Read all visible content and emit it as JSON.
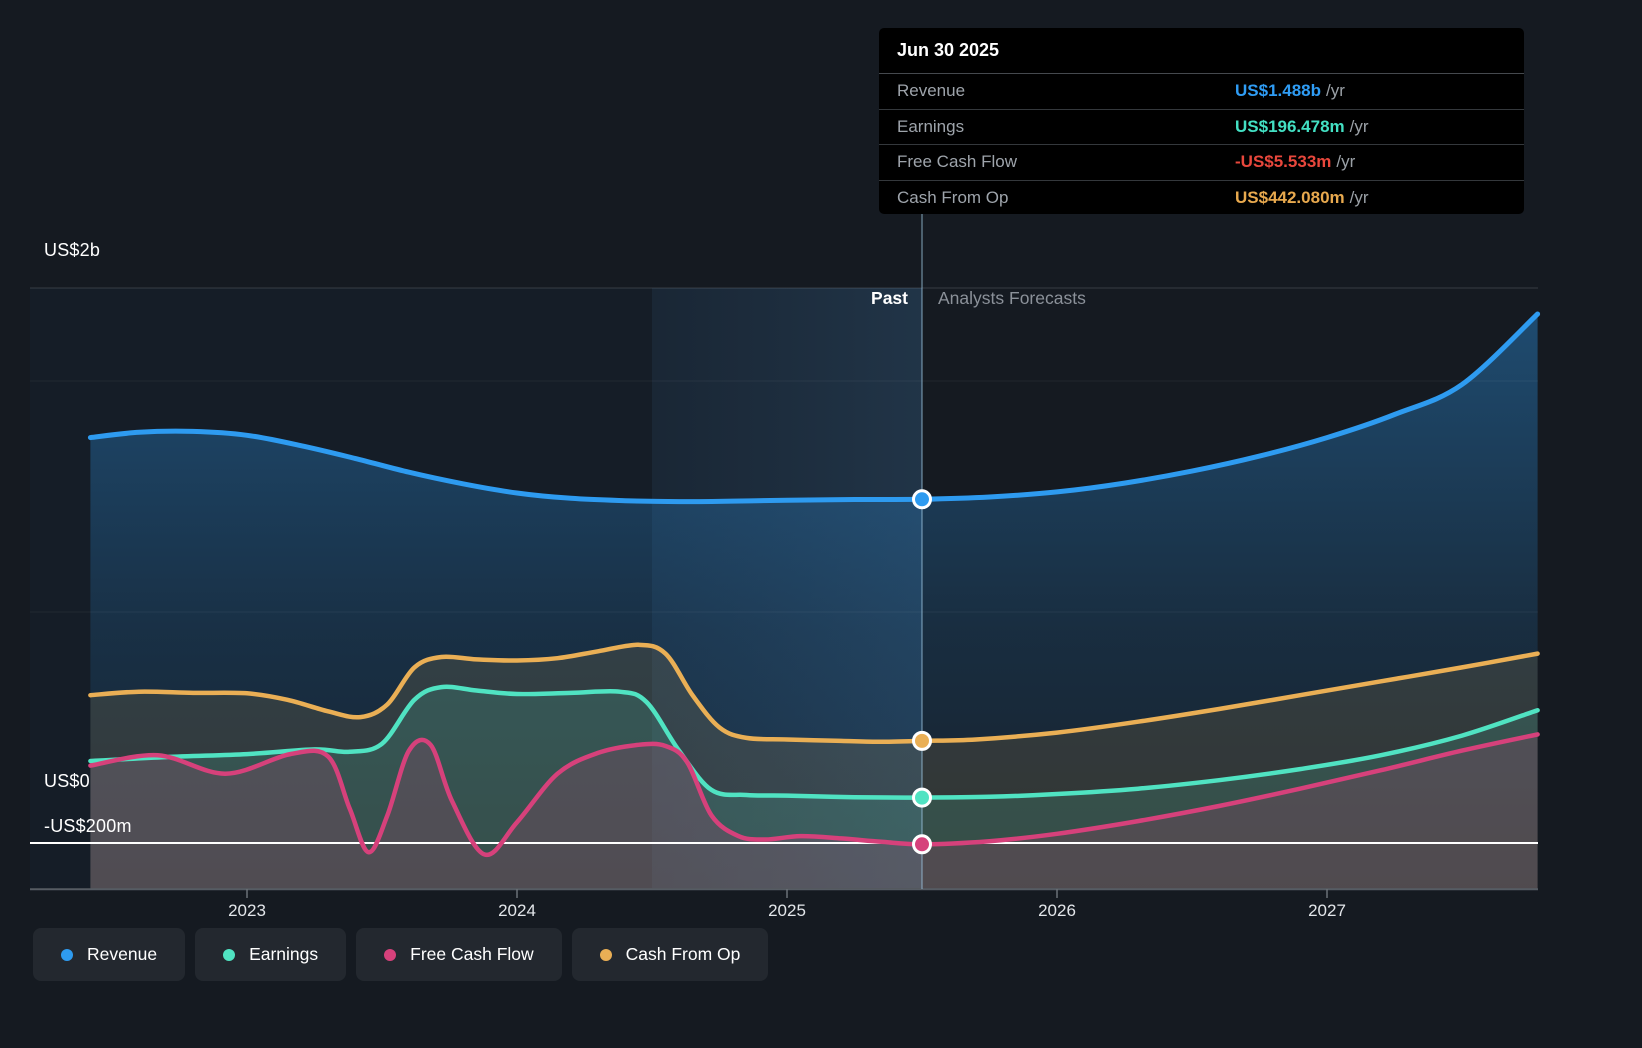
{
  "page_colors": {
    "background": "#151a21",
    "zero_line": "#ffffff",
    "axis_line": "#565c64",
    "divider": "#9cc4e0"
  },
  "tooltip": {
    "title": "Jun 30 2025",
    "rows": [
      {
        "label": "Revenue",
        "value": "US$1.488b",
        "unit": "/yr",
        "color": "#2f9cf4"
      },
      {
        "label": "Earnings",
        "value": "US$196.478m",
        "unit": "/yr",
        "color": "#43e0c3"
      },
      {
        "label": "Free Cash Flow",
        "value": "-US$5.533m",
        "unit": "/yr",
        "color": "#e8473c"
      },
      {
        "label": "Cash From Op",
        "value": "US$442.080m",
        "unit": "/yr",
        "color": "#e8a94e"
      }
    ]
  },
  "annotations": {
    "past": "Past",
    "forecasts": "Analysts Forecasts"
  },
  "legend": {
    "items": [
      {
        "label": "Revenue",
        "color": "#2e9bf0"
      },
      {
        "label": "Earnings",
        "color": "#50e3c2"
      },
      {
        "label": "Free Cash Flow",
        "color": "#d6417b"
      },
      {
        "label": "Cash From Op",
        "color": "#eaaf55"
      }
    ]
  },
  "chart_data": {
    "type": "area",
    "title": "Past and future earnings and revenue growth",
    "unit": "US$ millions per year",
    "x_axis": {
      "ticks": [
        "2023",
        "2024",
        "2025",
        "2026",
        "2027"
      ],
      "range": [
        2022.42,
        2027.78
      ]
    },
    "y_axis": {
      "labels": [
        {
          "text": "US$2b",
          "value": 2000
        },
        {
          "text": "US$0",
          "value": 0
        },
        {
          "text": "-US$200m",
          "value": -200
        }
      ],
      "gridlines_musd": [
        2000,
        1000,
        0,
        -200
      ]
    },
    "divider_x": 2025.5,
    "highlight_band_x": [
      2024.5,
      2025.5
    ],
    "series": [
      {
        "name": "Revenue",
        "color": "#2e9bf0",
        "points": [
          [
            2022.42,
            1755
          ],
          [
            2022.6,
            1778
          ],
          [
            2022.8,
            1782
          ],
          [
            2023.0,
            1765
          ],
          [
            2023.2,
            1720
          ],
          [
            2023.4,
            1665
          ],
          [
            2023.6,
            1605
          ],
          [
            2023.8,
            1555
          ],
          [
            2024.0,
            1515
          ],
          [
            2024.2,
            1492
          ],
          [
            2024.4,
            1482
          ],
          [
            2024.6,
            1478
          ],
          [
            2024.8,
            1480
          ],
          [
            2025.0,
            1484
          ],
          [
            2025.25,
            1487
          ],
          [
            2025.5,
            1488
          ],
          [
            2025.75,
            1498
          ],
          [
            2026.0,
            1520
          ],
          [
            2026.25,
            1558
          ],
          [
            2026.5,
            1610
          ],
          [
            2026.75,
            1675
          ],
          [
            2027.0,
            1755
          ],
          [
            2027.25,
            1855
          ],
          [
            2027.5,
            1985
          ],
          [
            2027.78,
            2290
          ]
        ]
      },
      {
        "name": "Cash From Op",
        "color": "#eaaf55",
        "points": [
          [
            2022.42,
            640
          ],
          [
            2022.6,
            655
          ],
          [
            2022.8,
            650
          ],
          [
            2023.0,
            648
          ],
          [
            2023.15,
            620
          ],
          [
            2023.3,
            570
          ],
          [
            2023.42,
            545
          ],
          [
            2023.52,
            600
          ],
          [
            2023.62,
            760
          ],
          [
            2023.72,
            805
          ],
          [
            2023.85,
            795
          ],
          [
            2024.0,
            790
          ],
          [
            2024.15,
            800
          ],
          [
            2024.3,
            830
          ],
          [
            2024.45,
            858
          ],
          [
            2024.55,
            820
          ],
          [
            2024.65,
            640
          ],
          [
            2024.75,
            500
          ],
          [
            2024.85,
            455
          ],
          [
            2025.0,
            448
          ],
          [
            2025.2,
            442
          ],
          [
            2025.35,
            438
          ],
          [
            2025.5,
            442.08
          ],
          [
            2025.7,
            448
          ],
          [
            2026.0,
            478
          ],
          [
            2026.3,
            525
          ],
          [
            2026.6,
            580
          ],
          [
            2026.9,
            640
          ],
          [
            2027.2,
            700
          ],
          [
            2027.5,
            760
          ],
          [
            2027.78,
            820
          ]
        ]
      },
      {
        "name": "Earnings",
        "color": "#50e3c2",
        "points": [
          [
            2022.42,
            355
          ],
          [
            2022.7,
            372
          ],
          [
            2023.0,
            385
          ],
          [
            2023.25,
            405
          ],
          [
            2023.38,
            395
          ],
          [
            2023.5,
            430
          ],
          [
            2023.62,
            620
          ],
          [
            2023.72,
            675
          ],
          [
            2023.85,
            660
          ],
          [
            2024.0,
            645
          ],
          [
            2024.2,
            650
          ],
          [
            2024.38,
            655
          ],
          [
            2024.48,
            610
          ],
          [
            2024.6,
            400
          ],
          [
            2024.72,
            230
          ],
          [
            2024.85,
            208
          ],
          [
            2025.0,
            205
          ],
          [
            2025.25,
            198
          ],
          [
            2025.5,
            196.478
          ],
          [
            2025.75,
            200
          ],
          [
            2026.0,
            212
          ],
          [
            2026.3,
            235
          ],
          [
            2026.6,
            272
          ],
          [
            2026.9,
            320
          ],
          [
            2027.2,
            380
          ],
          [
            2027.5,
            465
          ],
          [
            2027.78,
            575
          ]
        ]
      },
      {
        "name": "Free Cash Flow",
        "color": "#d6417b",
        "points": [
          [
            2022.42,
            335
          ],
          [
            2022.67,
            380
          ],
          [
            2022.92,
            300
          ],
          [
            2023.16,
            385
          ],
          [
            2023.3,
            375
          ],
          [
            2023.38,
            150
          ],
          [
            2023.45,
            -40
          ],
          [
            2023.52,
            120
          ],
          [
            2023.6,
            400
          ],
          [
            2023.68,
            425
          ],
          [
            2023.76,
            180
          ],
          [
            2023.88,
            -50
          ],
          [
            2024.0,
            90
          ],
          [
            2024.15,
            300
          ],
          [
            2024.3,
            390
          ],
          [
            2024.45,
            425
          ],
          [
            2024.55,
            420
          ],
          [
            2024.63,
            350
          ],
          [
            2024.72,
            120
          ],
          [
            2024.82,
            30
          ],
          [
            2024.92,
            15
          ],
          [
            2025.05,
            30
          ],
          [
            2025.2,
            20
          ],
          [
            2025.35,
            5
          ],
          [
            2025.5,
            -5.533
          ],
          [
            2025.75,
            8
          ],
          [
            2026.0,
            40
          ],
          [
            2026.3,
            95
          ],
          [
            2026.6,
            160
          ],
          [
            2026.9,
            235
          ],
          [
            2027.2,
            315
          ],
          [
            2027.5,
            400
          ],
          [
            2027.78,
            470
          ]
        ]
      }
    ],
    "markers": [
      {
        "series": "Revenue",
        "x": 2025.5,
        "value": 1488
      },
      {
        "series": "Cash From Op",
        "x": 2025.5,
        "value": 442.08
      },
      {
        "series": "Earnings",
        "x": 2025.5,
        "value": 196.478
      },
      {
        "series": "Free Cash Flow",
        "x": 2025.5,
        "value": -5.533
      }
    ]
  }
}
